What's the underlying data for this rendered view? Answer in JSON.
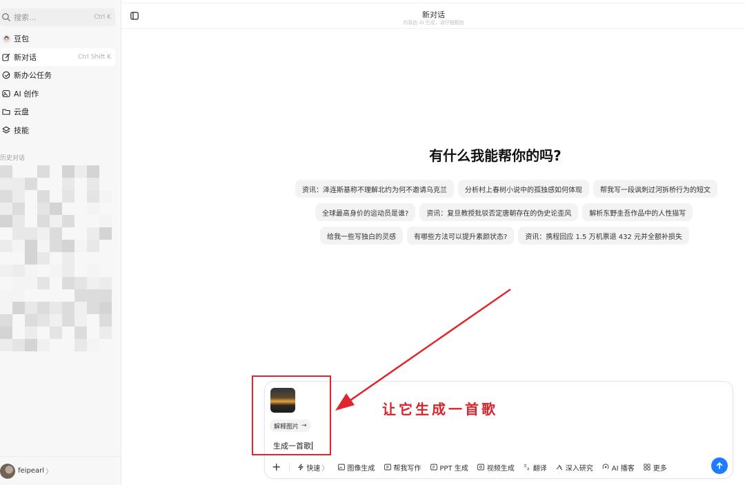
{
  "sidebar": {
    "search": {
      "placeholder": "搜索...",
      "shortcut": "Ctrl K"
    },
    "items": [
      {
        "label": "豆包",
        "icon": "doubao-avatar-icon",
        "shortcut": ""
      },
      {
        "label": "新对话",
        "icon": "edit-icon",
        "shortcut": "Ctrl Shift K"
      },
      {
        "label": "新办公任务",
        "icon": "office-task-icon",
        "shortcut": ""
      },
      {
        "label": "AI 创作",
        "icon": "image-create-icon",
        "shortcut": ""
      },
      {
        "label": "云盘",
        "icon": "folder-icon",
        "shortcut": ""
      },
      {
        "label": "技能",
        "icon": "skills-icon",
        "shortcut": ""
      }
    ],
    "history_title": "历史对话",
    "user": {
      "name": "feipearl",
      "arrow": "〉"
    }
  },
  "header": {
    "title": "新对话",
    "subtitle": "内容由 AI 生成，请仔细甄别"
  },
  "main": {
    "hero": "有什么我能帮你的吗?",
    "suggestions": [
      [
        "资讯：泽连斯基称不理解北约为何不邀请乌克兰",
        "分析村上春树小说中的孤独感如何体现",
        "帮我写一段讽刺过河拆桥行为的短文"
      ],
      [
        "全球最高身价的运动员是谁?",
        "资讯：复旦教授批驳否定唐朝存在的伪史论歪风",
        "解析东野圭吾作品中的人性描写"
      ],
      [
        "给我一些写独白的灵感",
        "有哪些方法可以提升素颜状态?",
        "资讯：携程回应 1.5 万机票退 432 元并全额补损失"
      ]
    ]
  },
  "composer": {
    "explain_chip": "解释图片",
    "explain_arrow": "→",
    "input_value": "生成一首歌",
    "plus": "+",
    "tools": [
      {
        "label": "快速",
        "icon": "lightning-icon"
      },
      {
        "label": "图像生成",
        "icon": "image-icon"
      },
      {
        "label": "帮我写作",
        "icon": "write-icon"
      },
      {
        "label": "PPT 生成",
        "icon": "ppt-icon"
      },
      {
        "label": "视频生成",
        "icon": "video-icon"
      },
      {
        "label": "翻译",
        "icon": "translate-icon"
      },
      {
        "label": "深入研究",
        "icon": "research-icon"
      },
      {
        "label": "AI 播客",
        "icon": "podcast-icon"
      },
      {
        "label": "更多",
        "icon": "grid-icon"
      }
    ],
    "quick_suffix": "〉"
  },
  "annotation": {
    "text": "让它生成一首歌",
    "color": "#d7232a"
  },
  "colors": {
    "accent": "#1f7bff",
    "annotation": "#e0262c"
  }
}
